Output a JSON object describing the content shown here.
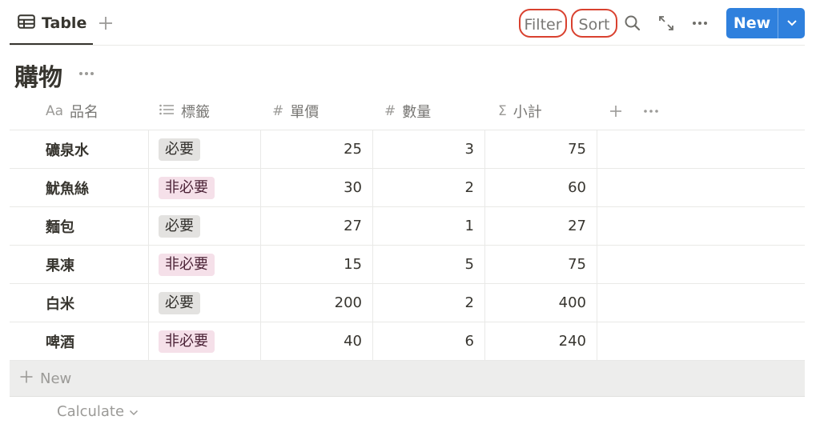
{
  "toolbar": {
    "tab_label": "Table",
    "filter_label": "Filter",
    "sort_label": "Sort",
    "new_label": "New"
  },
  "page": {
    "title": "購物"
  },
  "table": {
    "columns": [
      {
        "icon": "Aa",
        "label": "品名"
      },
      {
        "icon": "list-icon",
        "label": "標籤"
      },
      {
        "icon": "#",
        "label": "單價"
      },
      {
        "icon": "#",
        "label": "數量"
      },
      {
        "icon": "Σ",
        "label": "小計"
      }
    ],
    "rows": [
      {
        "name": "礦泉水",
        "tag": "必要",
        "price": "25",
        "qty": "3",
        "subtotal": "75"
      },
      {
        "name": "魷魚絲",
        "tag": "非必要",
        "price": "30",
        "qty": "2",
        "subtotal": "60"
      },
      {
        "name": "麵包",
        "tag": "必要",
        "price": "27",
        "qty": "1",
        "subtotal": "27"
      },
      {
        "name": "果凍",
        "tag": "非必要",
        "price": "15",
        "qty": "5",
        "subtotal": "75"
      },
      {
        "name": "白米",
        "tag": "必要",
        "price": "200",
        "qty": "2",
        "subtotal": "400"
      },
      {
        "name": "啤酒",
        "tag": "非必要",
        "price": "40",
        "qty": "6",
        "subtotal": "240"
      }
    ],
    "new_row_label": "New",
    "calculate_label": "Calculate"
  },
  "colors": {
    "accent": "#2f80dd",
    "highlight_ring": "#d9412f",
    "tag_required_bg": "#e3e2e0",
    "tag_optional_bg": "#f5e0e9"
  }
}
